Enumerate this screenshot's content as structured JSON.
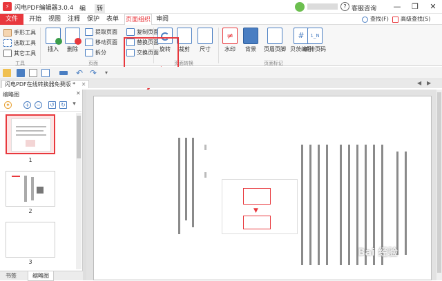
{
  "title_bar": {
    "app_title": "闪电PDF编辑器3.0.4",
    "contextual_tabs": [
      "编辑",
      "转换"
    ],
    "help_label": "客服咨询",
    "window_buttons": {
      "minimize": "—",
      "restore": "❐",
      "close": "✕"
    }
  },
  "menu": {
    "items": [
      "文件",
      "开始",
      "视图",
      "注释",
      "保护",
      "表单",
      "页面组织",
      "审阅"
    ],
    "active": "页面组织",
    "search_label": "查找(F)",
    "adv_search_label": "高级查找(S)"
  },
  "ribbon": {
    "tools_group": {
      "label": "工具",
      "items": [
        "手形工具",
        "选取工具",
        "其它工具"
      ]
    },
    "page_group": {
      "label": "页面",
      "big": [
        "插入",
        "删除",
        "拆分"
      ],
      "small": [
        "提取页面",
        "移动页面",
        "复制页面",
        "替换页面",
        "交换页面"
      ]
    },
    "transform_group": {
      "label": "页面转换",
      "big": [
        "旋转",
        "裁剪",
        "尺寸"
      ]
    },
    "mark_group": {
      "label": "页面标记",
      "big": [
        "水印",
        "背景",
        "页眉页脚",
        "贝茨编号",
        "编排页码"
      ]
    },
    "colors": {
      "accent": "#e8383d",
      "blue": "#4a7ec2",
      "green": "#3a9d4a",
      "orange": "#f0a030"
    }
  },
  "document": {
    "tab_title": "闪电PDF在线转换器免费版 *",
    "close_glyph": "✕"
  },
  "thumbnails": {
    "panel_title": "缩略图",
    "close_glyph": "✕",
    "pages": [
      "1",
      "2",
      "3"
    ],
    "selected": "1"
  },
  "bottom_tabs": [
    "书签",
    "缩略图"
  ],
  "watermark": "Bai 经验"
}
